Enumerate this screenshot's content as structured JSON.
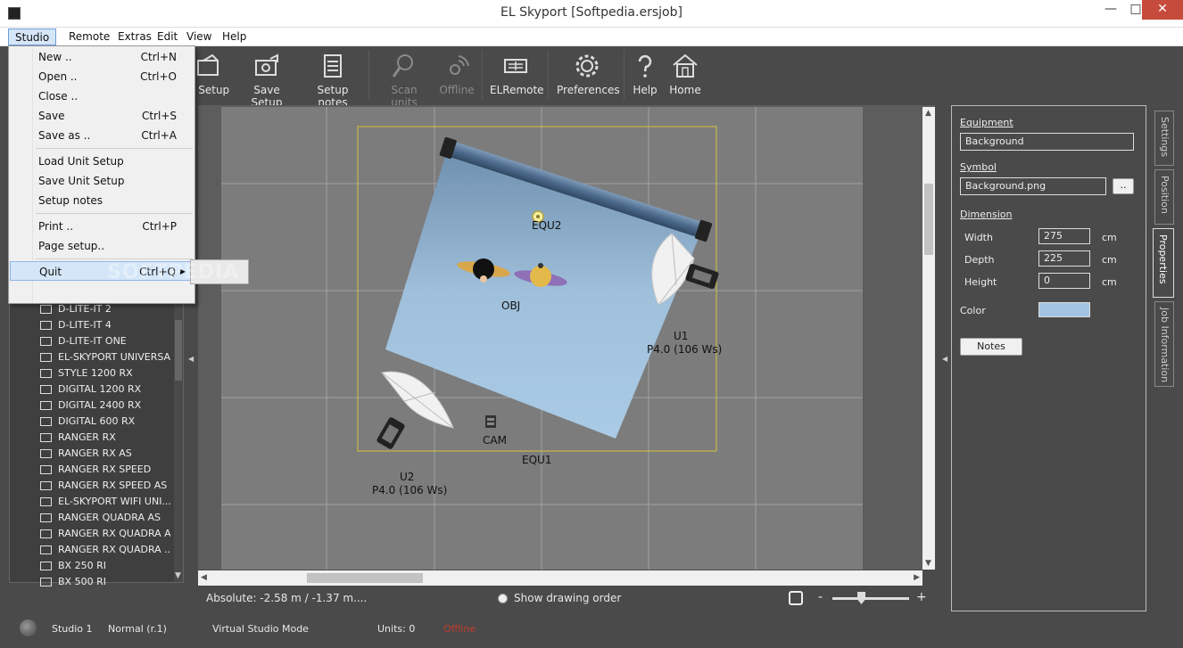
{
  "window": {
    "title": "EL Skyport [Softpedia.ersjob]"
  },
  "menubar": [
    "Studio",
    "Remote",
    "Extras",
    "Edit",
    "View",
    "Help"
  ],
  "studio_menu": {
    "items": [
      {
        "label": "New ..",
        "shortcut": "Ctrl+N"
      },
      {
        "label": "Open ..",
        "shortcut": "Ctrl+O"
      },
      {
        "label": "Close ..",
        "shortcut": ""
      },
      {
        "label": "Save",
        "shortcut": "Ctrl+S"
      },
      {
        "label": "Save as ..",
        "shortcut": "Ctrl+A"
      },
      {
        "label": "Load Unit Setup",
        "shortcut": ""
      },
      {
        "label": "Save Unit Setup",
        "shortcut": ""
      },
      {
        "label": "Setup notes",
        "shortcut": ""
      },
      {
        "label": "Print ..",
        "shortcut": "Ctrl+P"
      },
      {
        "label": "Page setup..",
        "shortcut": ""
      },
      {
        "label": "Quit",
        "shortcut": "Ctrl+Q"
      }
    ]
  },
  "toolbar": {
    "load_setup": "d Setup",
    "save_setup": "Save Setup",
    "setup_notes": "Setup notes",
    "scan_units": "Scan units",
    "offline": "Offline",
    "elremote": "ELRemote",
    "preferences": "Preferences",
    "help": "Help",
    "home": "Home"
  },
  "unit_list": [
    "D-LITE-IT 2",
    "D-LITE-IT 4",
    "D-LITE-IT ONE",
    "EL-SKYPORT UNIVERSAL",
    "STYLE 1200 RX",
    "DIGITAL 1200 RX",
    "DIGITAL 2400 RX",
    "DIGITAL 600 RX",
    "RANGER RX",
    "RANGER RX AS",
    "RANGER RX SPEED",
    "RANGER RX SPEED AS",
    "EL-SKYPORT WIFI UNI...",
    "RANGER QUADRA AS",
    "RANGER RX QUADRA AS",
    "RANGER RX QUADRA ...",
    "BX 250 RI",
    "BX 500 RI"
  ],
  "canvas": {
    "watermark": "SOFTPEDIA",
    "labels": {
      "equ2": "EQU2",
      "obj": "OBJ",
      "u1_name": "U1",
      "u1_power": "P4.0 (106 Ws)",
      "u2_name": "U2",
      "u2_power": "P4.0 (106 Ws)",
      "cam": "CAM",
      "equ1": "EQU1"
    },
    "background_color": "#a3c4e2"
  },
  "infobar": {
    "absolute": "Absolute: -2.58 m / -1.37 m",
    "dots": "....",
    "show_drawing_order": "Show drawing order",
    "zoom_minus": "-",
    "zoom_plus": "+"
  },
  "properties": {
    "equipment_label": "Equipment",
    "equipment_value": "Background",
    "symbol_label": "Symbol",
    "symbol_value": "Background.png",
    "browse_label": "..",
    "dimension_label": "Dimension",
    "width_label": "Width",
    "width_value": "275",
    "depth_label": "Depth",
    "depth_value": "225",
    "height_label": "Height",
    "height_value": "0",
    "unit": "cm",
    "color_label": "Color",
    "color_value": "#a3c4e2",
    "notes_label": "Notes"
  },
  "side_tabs": [
    "Settings",
    "Position",
    "Properties",
    "Job Information"
  ],
  "statusbar": {
    "studio": "Studio 1",
    "mode": "Normal (r.1)",
    "virtual": "Virtual Studio Mode",
    "units": "Units: 0",
    "offline": "Offline"
  }
}
